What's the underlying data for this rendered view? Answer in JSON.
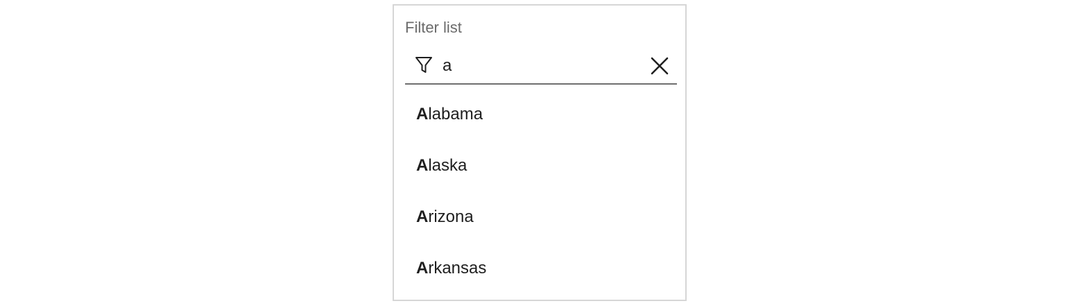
{
  "filter": {
    "label": "Filter list",
    "query": "a",
    "filter_icon": "filter-funnel-icon",
    "clear_icon": "close-icon"
  },
  "results": [
    {
      "match": "A",
      "rest": "labama"
    },
    {
      "match": "A",
      "rest": "laska"
    },
    {
      "match": "A",
      "rest": "rizona"
    },
    {
      "match": "A",
      "rest": "rkansas"
    }
  ]
}
